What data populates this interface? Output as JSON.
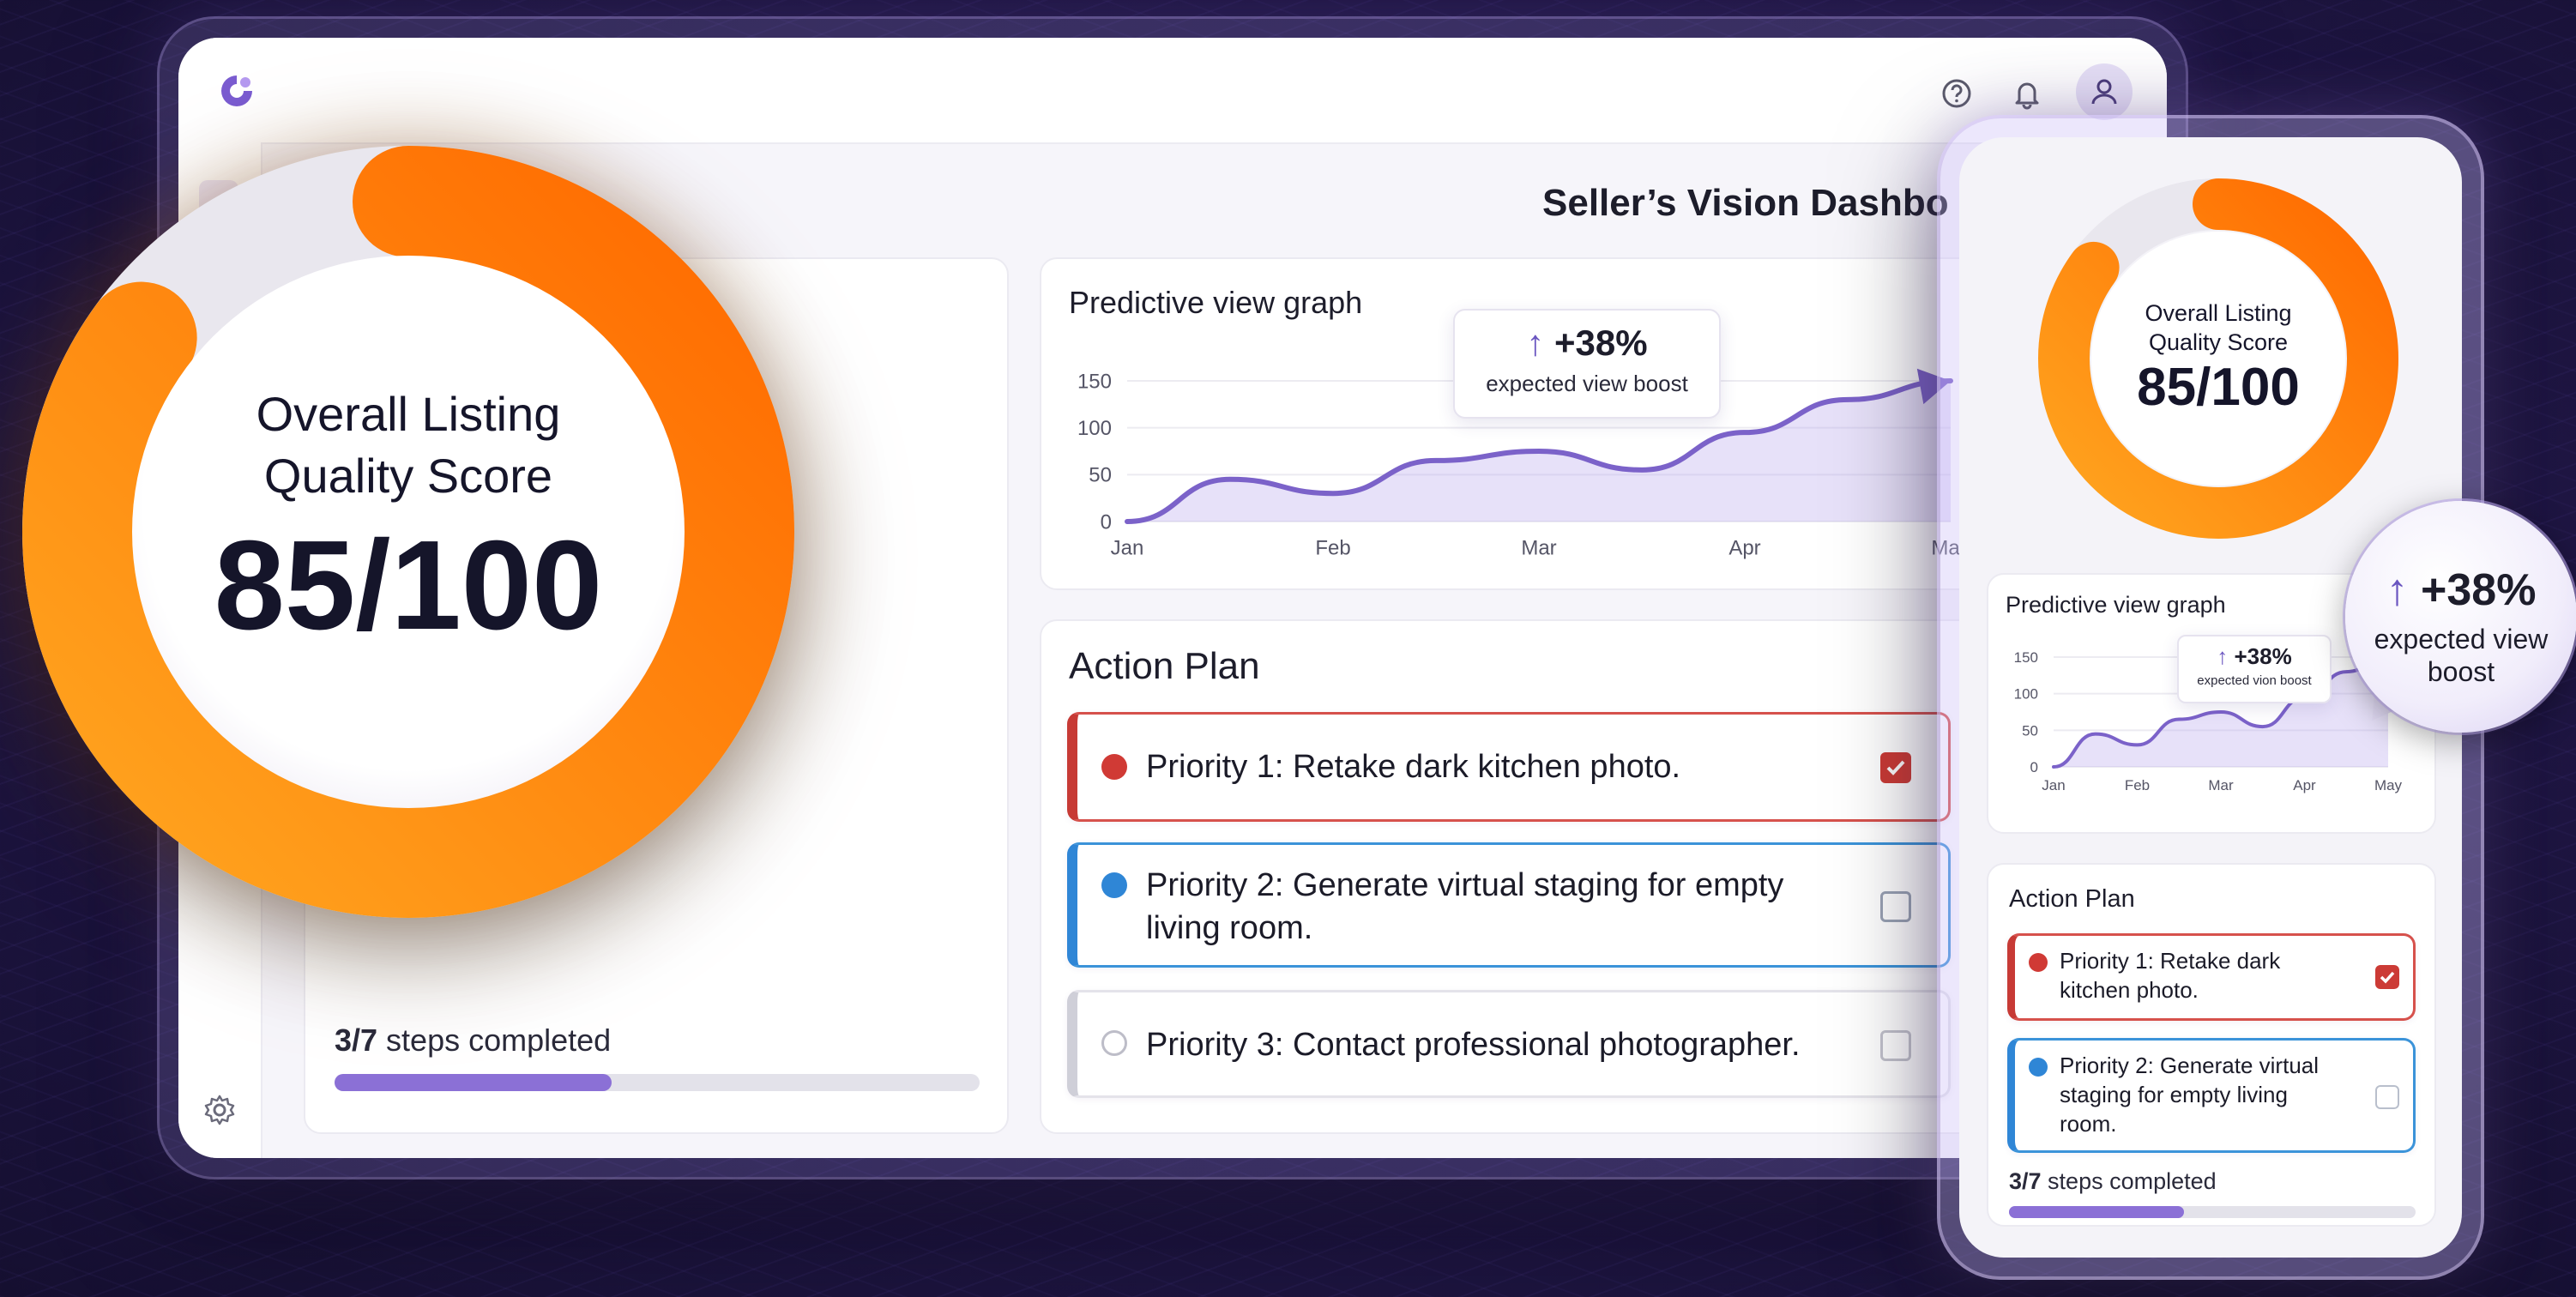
{
  "dashboard": {
    "title": "Seller’s Vision Dashbo",
    "steps_completed": "3/7 steps completed",
    "progress_fraction": 0.43
  },
  "score": {
    "title_line1": "Overall Listing",
    "title_line2": "Quality Score",
    "value": "85/100",
    "percent": 85
  },
  "graph": {
    "title": "Predictive view graph",
    "callout_value": "+38%",
    "callout_label": "expected view boost"
  },
  "action_plan": {
    "title": "Action Plan",
    "items": [
      {
        "label": "Priority 1: Retake dark kitchen photo.",
        "color": "#d03a35",
        "checked": true
      },
      {
        "label_line1": "Priority 2: Generate virtual staging for empty",
        "label_line2": "living room.",
        "color": "#2f86d6",
        "checked": false
      },
      {
        "label": "Priority 3: Contact professional photographer.",
        "color": "#c9c9d3",
        "checked": false
      }
    ]
  },
  "phone": {
    "score_line1": "Overall Listing",
    "score_line2": "Quality Score",
    "score_value": "85/100",
    "graph_title": "Predictive view graph",
    "callout_value": "+38%",
    "callout_label": "expected vion boost",
    "action_title": "Action Plan",
    "item1_line1": "Priority 1: Retake dark",
    "item1_line2": "kitchen photo.",
    "item2_line1": "Priority 2: Generate virtual",
    "item2_line2": "staging for empty living",
    "item2_line3": "room.",
    "steps_completed": "3/7 steps completed"
  },
  "bubble": {
    "value": "+38%",
    "label_line1": "expected view",
    "label_line2": "boost"
  },
  "icons": {
    "help": "help-icon",
    "notifications": "bell-icon",
    "user": "user-icon",
    "settings": "gear-icon",
    "logo": "logo-icon"
  },
  "colors": {
    "accent": "#8b70d6",
    "gauge_orange": "#ff8a0a",
    "gauge_track": "#e9e7ee"
  },
  "chart_data": {
    "type": "area",
    "title": "Predictive view graph",
    "categories": [
      "Jan",
      "Feb",
      "Mar",
      "Apr",
      "May"
    ],
    "x": [
      0,
      0.5,
      1,
      1.5,
      2,
      2.5,
      3,
      3.5,
      4
    ],
    "values": [
      0,
      45,
      30,
      65,
      75,
      55,
      95,
      130,
      150
    ],
    "yticks": [
      0,
      50,
      100,
      150
    ],
    "ylim": [
      0,
      150
    ],
    "annotation": "+38% expected view boost"
  }
}
